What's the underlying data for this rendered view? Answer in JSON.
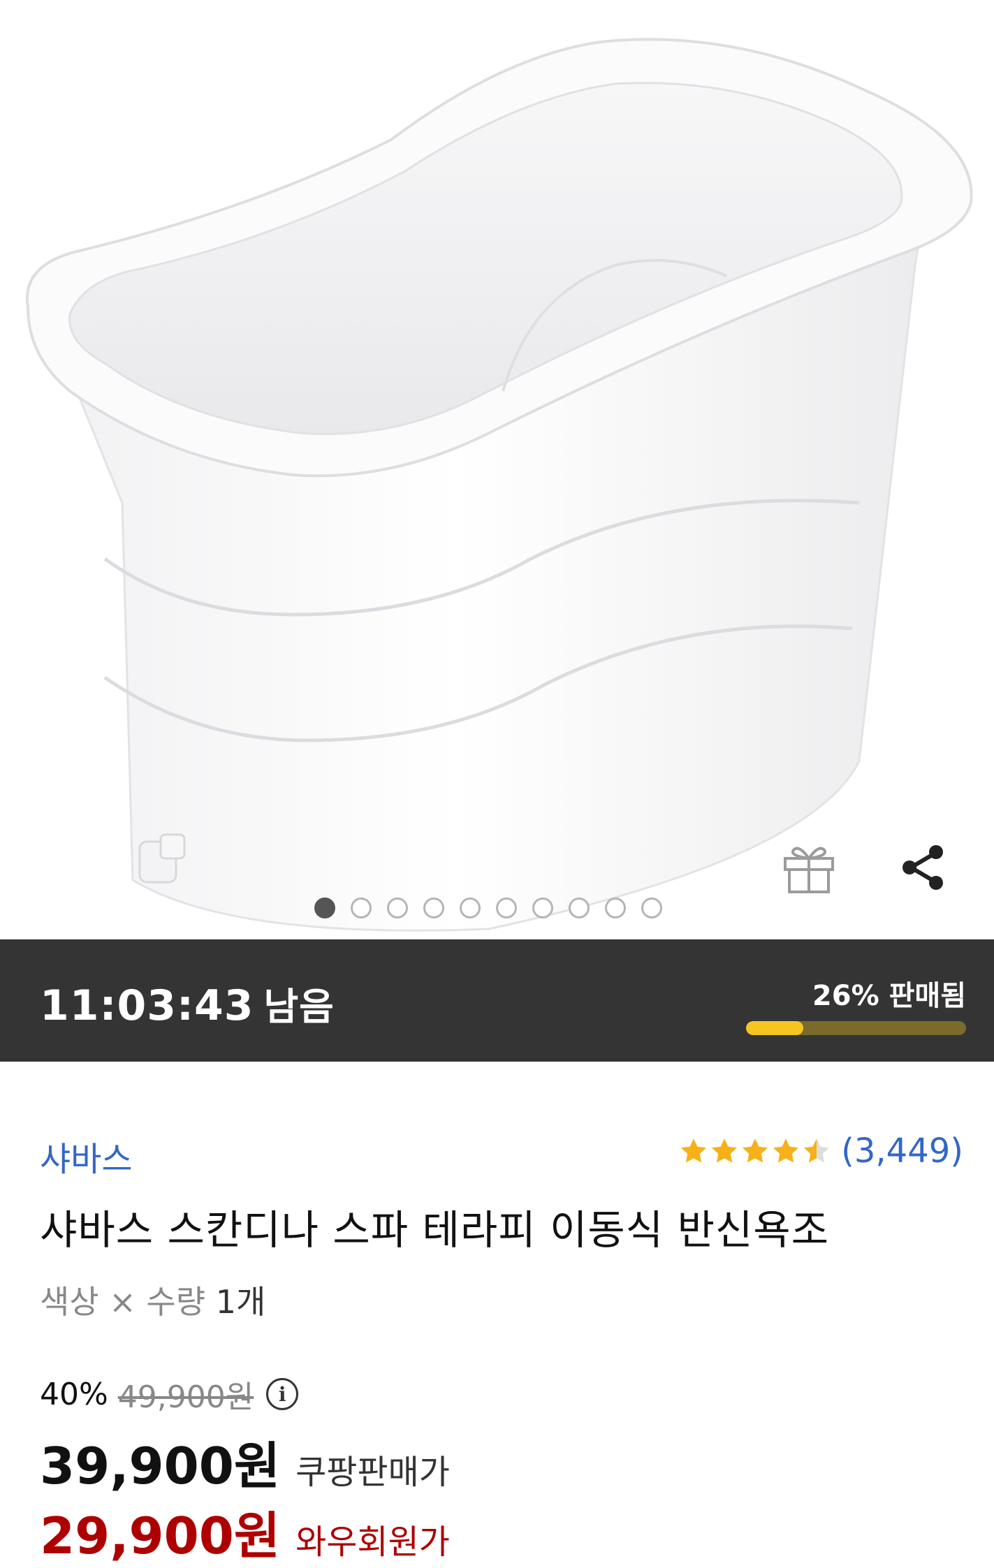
{
  "hero": {
    "image_subject": "white portable half-body bathtub",
    "carousel_total": 10,
    "carousel_active_index": 0,
    "gift_icon": "gift-icon",
    "share_icon": "share-icon"
  },
  "deal": {
    "time_left": "11:03:43",
    "time_left_suffix": "남음",
    "sold_text": "26% 판매됨",
    "sold_fraction": 0.26,
    "colors": {
      "bar_bg": "#343434",
      "progress_fill": "#f6c521",
      "progress_track": "#7a6a2c"
    }
  },
  "product": {
    "brand": "샤바스",
    "rating_value": 4.5,
    "rating_count": "(3,449)",
    "title": "샤바스 스칸디나 스파 테라피 이동식 반신욕조",
    "option_label": "색상 × 수량",
    "option_qty": "1개"
  },
  "pricing": {
    "discount_rate": "40%",
    "original_price": "49,900원",
    "sale_price": "39,900원",
    "sale_label": "쿠팡판매가",
    "member_price": "29,900원",
    "member_label": "와우회원가",
    "colors": {
      "member": "#ae0000",
      "link": "#3466c7",
      "star": "#f6b119"
    }
  }
}
